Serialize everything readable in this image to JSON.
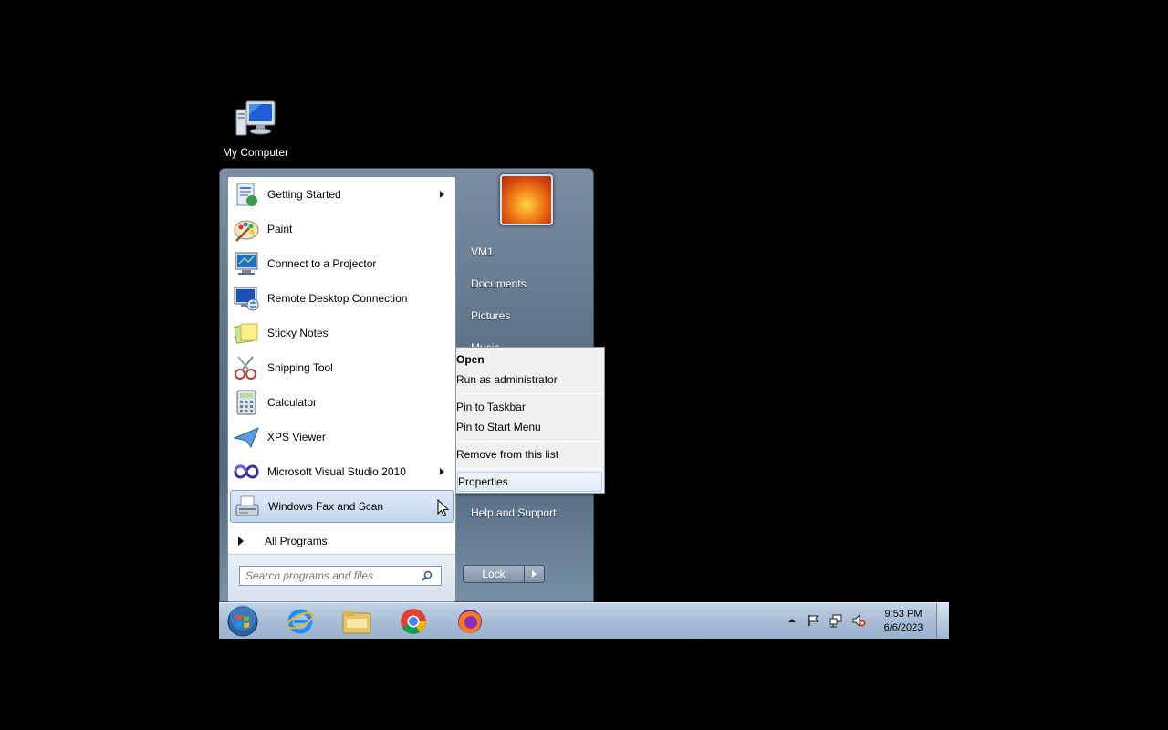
{
  "desktop": {
    "icons": [
      {
        "label": "My Computer",
        "icon": "computer-icon"
      }
    ]
  },
  "start_menu": {
    "programs": [
      {
        "label": "Getting Started",
        "icon": "getting-started-icon",
        "submenu": true
      },
      {
        "label": "Paint",
        "icon": "paint-icon",
        "submenu": false
      },
      {
        "label": "Connect to a Projector",
        "icon": "projector-icon",
        "submenu": false
      },
      {
        "label": "Remote Desktop Connection",
        "icon": "remote-desktop-icon",
        "submenu": false
      },
      {
        "label": "Sticky Notes",
        "icon": "sticky-notes-icon",
        "submenu": false
      },
      {
        "label": "Snipping Tool",
        "icon": "snipping-tool-icon",
        "submenu": false
      },
      {
        "label": "Calculator",
        "icon": "calculator-icon",
        "submenu": false
      },
      {
        "label": "XPS Viewer",
        "icon": "xps-viewer-icon",
        "submenu": false
      },
      {
        "label": "Microsoft Visual Studio 2010",
        "icon": "visual-studio-icon",
        "submenu": true
      },
      {
        "label": "Windows Fax and Scan",
        "icon": "fax-scan-icon",
        "submenu": true,
        "highlighted": true
      }
    ],
    "all_programs": "All Programs",
    "search_placeholder": "Search programs and files",
    "right_items": [
      {
        "label": "VM1"
      },
      {
        "label": "Documents"
      },
      {
        "label": "Pictures"
      },
      {
        "label": "Music"
      },
      {
        "label": "Help and Support"
      }
    ],
    "lock_label": "Lock"
  },
  "context_menu": {
    "items": [
      {
        "label": "Open",
        "bold": true
      },
      {
        "label": "Run as administrator"
      },
      {
        "label": "Pin to Taskbar"
      },
      {
        "label": "Pin to Start Menu"
      },
      {
        "label": "Remove from this list"
      },
      {
        "label": "Properties",
        "highlighted": true
      }
    ]
  },
  "taskbar": {
    "pinned": [
      "internet-explorer-icon",
      "file-explorer-icon",
      "chrome-icon",
      "firefox-icon"
    ],
    "tray_icons": [
      "show-hidden-icons-arrow",
      "action-center-flag-icon",
      "network-icon",
      "volume-muted-icon"
    ],
    "time": "9:53 PM",
    "date": "6/6/2023"
  },
  "colors": {
    "accent": "#7da2ce",
    "taskbar": "#a8bdd6",
    "start_menu": "#5f7389"
  }
}
